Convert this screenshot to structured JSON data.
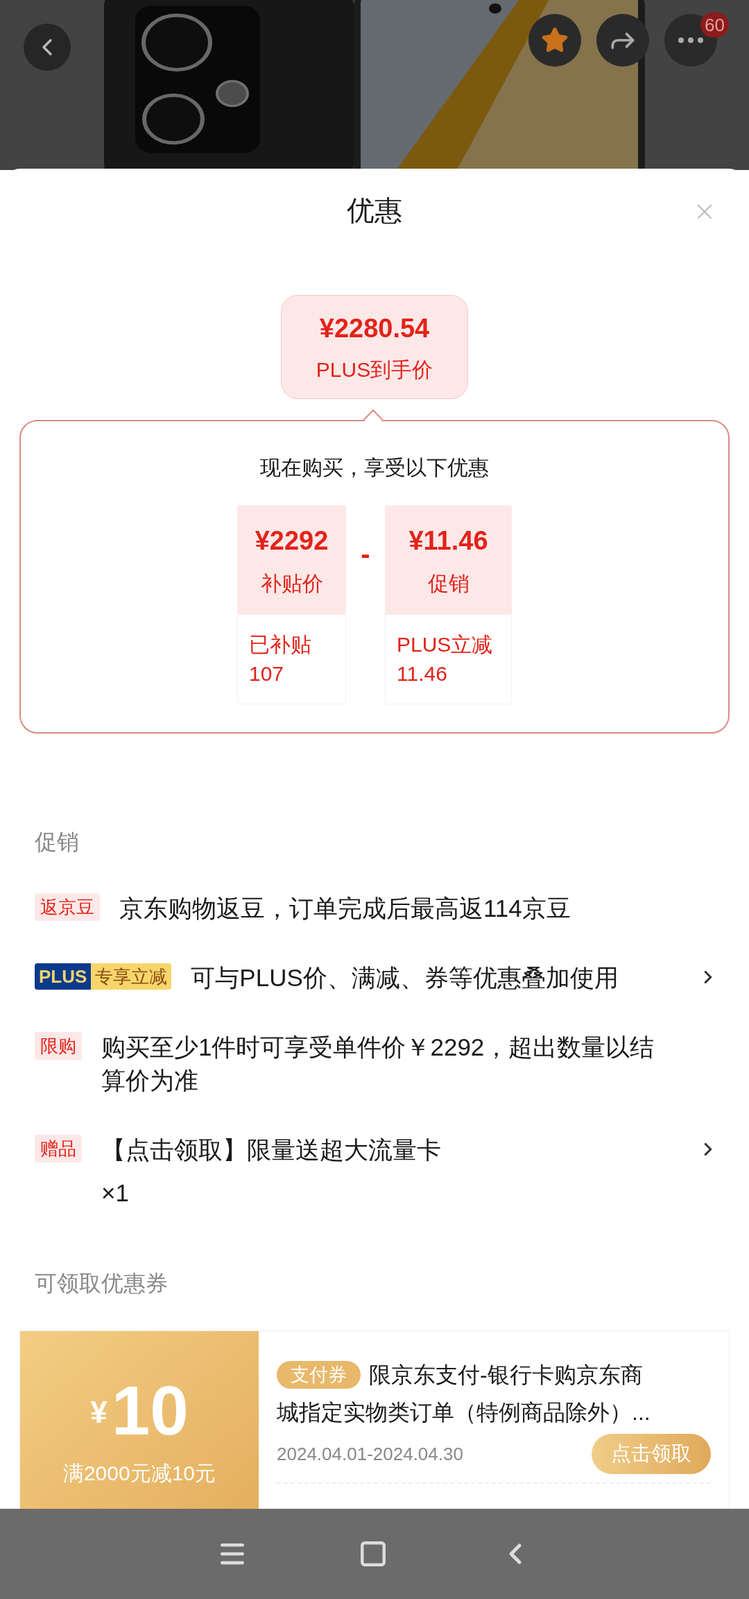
{
  "top_bar": {
    "badge": "60"
  },
  "sheet": {
    "title": "优惠"
  },
  "final_price": {
    "price": "¥2280.54",
    "label": "PLUS到手价"
  },
  "breakdown": {
    "heading": "现在购买，享受以下优惠",
    "operator": "-",
    "items": [
      {
        "amount": "¥2292",
        "label": "补贴价",
        "detail": [
          "已补贴",
          "107"
        ]
      },
      {
        "amount": "¥11.46",
        "label": "促销",
        "detail": [
          "PLUS立减",
          "11.46"
        ]
      }
    ]
  },
  "promotions": {
    "heading": "促销",
    "items": [
      {
        "kind": "tag",
        "tag": "返京豆",
        "text": "京东购物返豆，订单完成后最高返114京豆",
        "arrow": false
      },
      {
        "kind": "plus",
        "tag": "PLUS",
        "tag_extra": "专享立减",
        "text": "可与PLUS价、满减、券等优惠叠加使用",
        "arrow": true
      },
      {
        "kind": "tag",
        "tag": "限购",
        "text": "购买至少1件时可享受单件价￥2292，超出数量以结算价为准",
        "arrow": false
      },
      {
        "kind": "tag",
        "tag": "赠品",
        "text": "【点击领取】限量送超大流量卡",
        "sub": "×1",
        "arrow": true
      }
    ]
  },
  "coupons": {
    "heading": "可领取优惠券",
    "items": [
      {
        "currency": "¥",
        "amount": "10",
        "condition": "满2000元减10元",
        "tag": "支付券",
        "description": [
          "限京东支付-银行卡购京东商",
          "城指定实物类订单（特例商品除外）..."
        ],
        "validity": "2024.04.01-2024.04.30",
        "button": "点击领取"
      }
    ]
  }
}
